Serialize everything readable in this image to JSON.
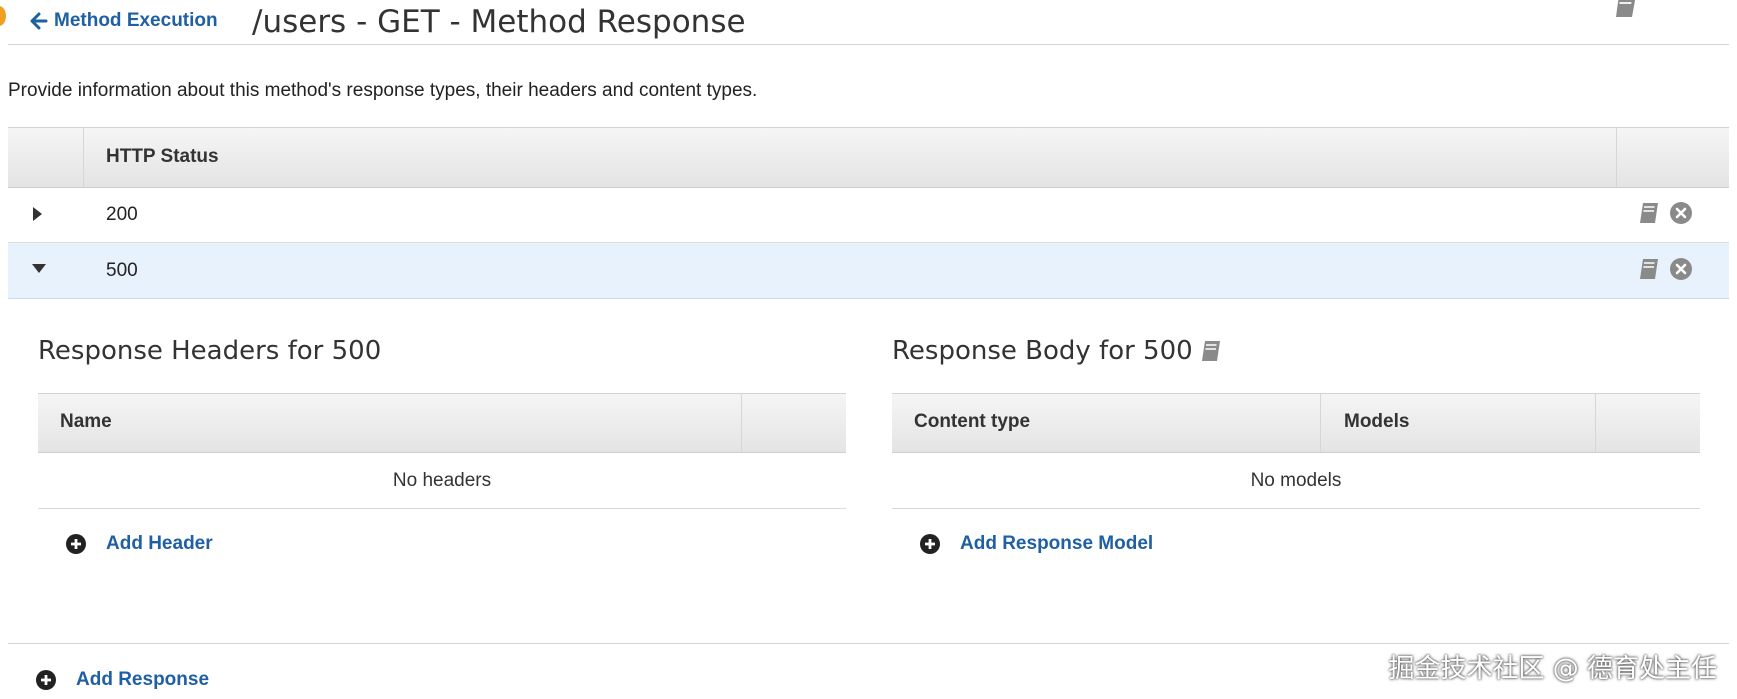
{
  "header": {
    "back_label": "Method Execution",
    "title": "/users - GET - Method Response",
    "icons": {
      "back": "arrow-left-icon",
      "docs": "book-icon"
    }
  },
  "description": "Provide information about this method's response types, their headers and content types.",
  "responses_table": {
    "columns": [
      "HTTP Status"
    ],
    "rows": [
      {
        "status": "200",
        "expanded": false
      },
      {
        "status": "500",
        "expanded": true
      }
    ]
  },
  "expanded_detail": {
    "headers_section": {
      "title": "Response Headers for 500",
      "columns": [
        "Name"
      ],
      "empty_text": "No headers",
      "add_label": "Add Header"
    },
    "body_section": {
      "title": "Response Body for 500",
      "columns": [
        "Content type",
        "Models"
      ],
      "empty_text": "No models",
      "add_label": "Add Response Model"
    }
  },
  "footer": {
    "add_response_label": "Add Response"
  },
  "watermark": "掘金技术社区 @ 德育处主任",
  "colors": {
    "link": "#1f5fa3",
    "expanded_row_bg": "#e8f2fc",
    "header_gradient_top": "#f5f5f5",
    "header_gradient_bottom": "#e4e4e4",
    "icon_gray": "#8a8a8a"
  }
}
